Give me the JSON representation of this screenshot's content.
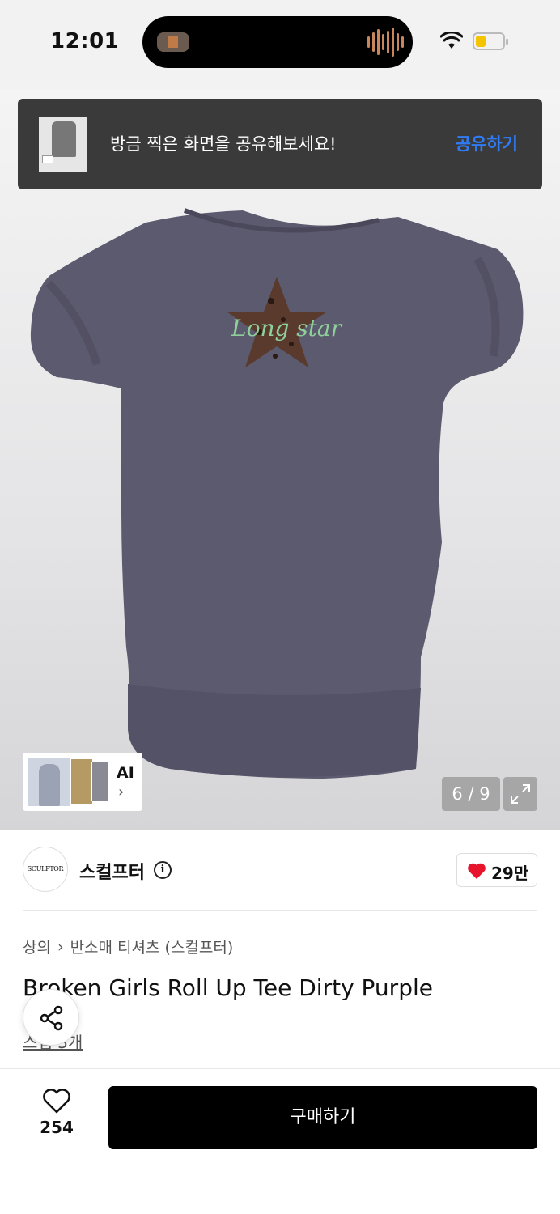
{
  "status_bar": {
    "time": "12:01"
  },
  "toast": {
    "message": "방금 찍은 화면을 공유해보세요!",
    "action": "공유하기"
  },
  "gallery": {
    "ai_label": "AI",
    "counter": "6 / 9",
    "print_text": "Long star"
  },
  "brand": {
    "logo_text": "SCULPTOR",
    "name": "스컬프터",
    "likes": "29만"
  },
  "product": {
    "breadcrumb": [
      "상의",
      "반소매 티셔츠 (스컬프터)"
    ],
    "title": "Broken Girls Roll Up Tee Dirty Purple",
    "review_link": "스냅 3개"
  },
  "bottom_bar": {
    "wishlist_count": "254",
    "buy_label": "구매하기"
  },
  "colors": {
    "accent_blue": "#2f7cf6",
    "heart_red": "#e8142c",
    "shirt": "#5c5a6e"
  }
}
